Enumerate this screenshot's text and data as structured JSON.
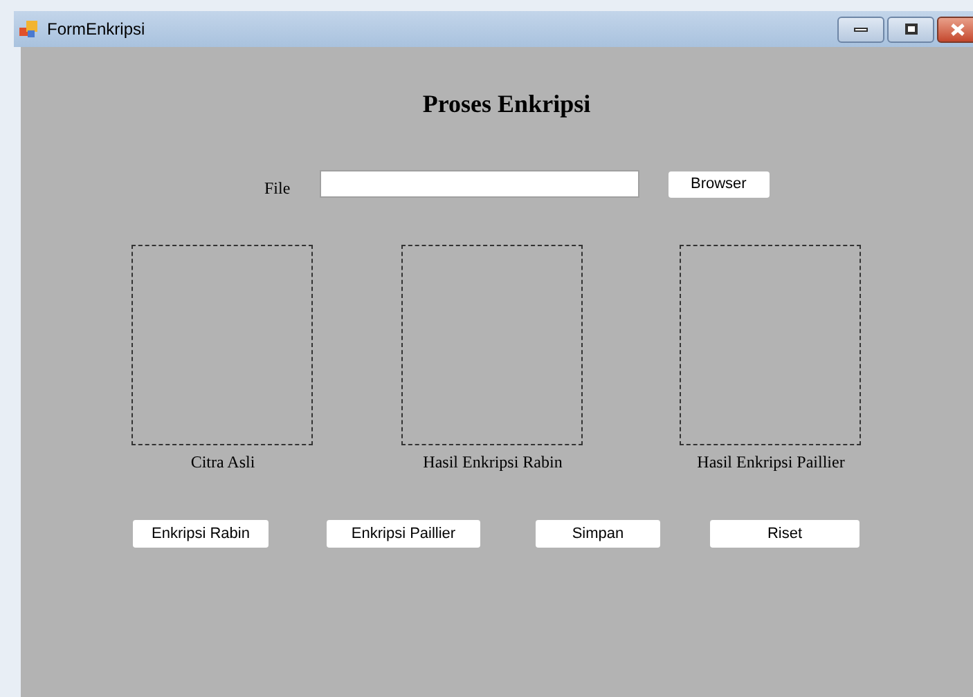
{
  "window": {
    "title": "FormEnkripsi"
  },
  "heading": "Proses Enkripsi",
  "file_field": {
    "label": "File"
  },
  "browse_button": "Browser",
  "image_boxes": [
    {
      "caption": "Citra Asli"
    },
    {
      "caption": "Hasil Enkripsi Rabin"
    },
    {
      "caption": "Hasil Enkripsi Paillier"
    }
  ],
  "buttons": [
    "Enkripsi Rabin",
    "Enkripsi Paillier",
    "Simpan",
    "Riset"
  ]
}
